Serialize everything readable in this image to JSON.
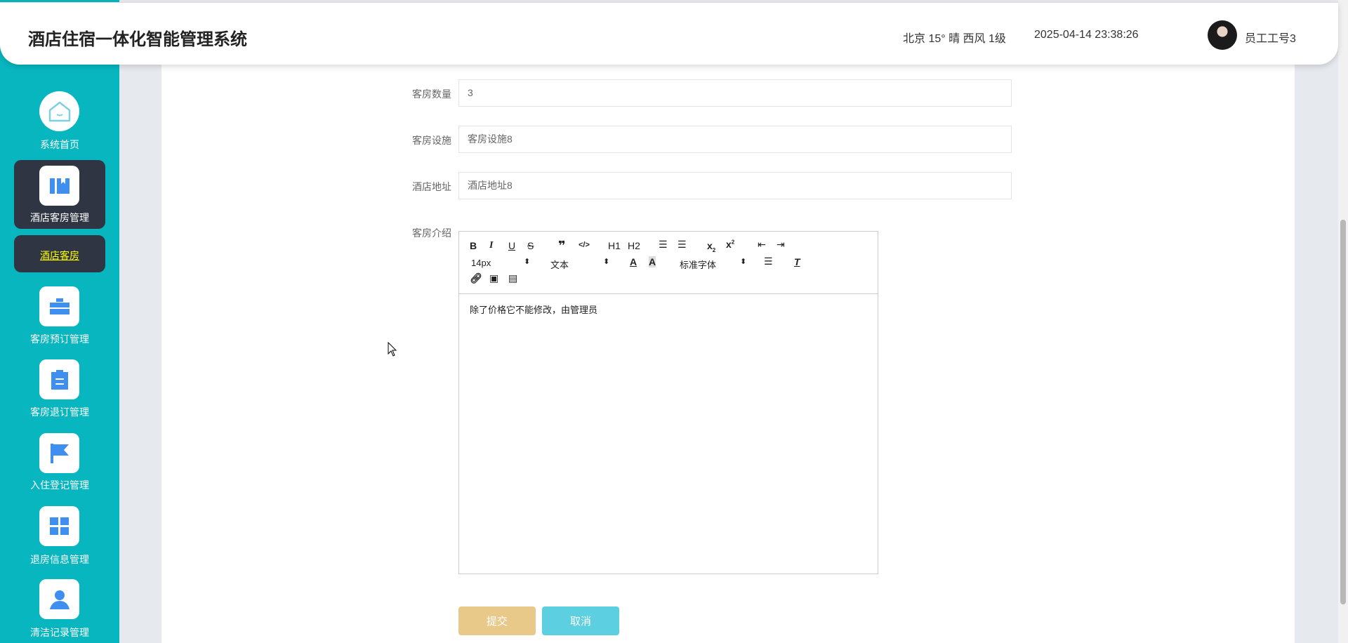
{
  "header": {
    "title": "酒店住宿一体化智能管理系统",
    "weather": "北京  15°  晴  西风  1级",
    "datetime": "2025-04-14 23:38:26",
    "username": "员工工号3"
  },
  "sidebar": {
    "items": [
      {
        "label": "系统首页",
        "icon": "home-icon"
      },
      {
        "label": "酒店客房管理",
        "icon": "book-icon",
        "active": true
      },
      {
        "label": "客房预订管理",
        "icon": "briefcase-icon"
      },
      {
        "label": "客房退订管理",
        "icon": "clipboard-icon"
      },
      {
        "label": "入住登记管理",
        "icon": "flag-icon"
      },
      {
        "label": "退房信息管理",
        "icon": "grid-icon"
      },
      {
        "label": "清洁记录管理",
        "icon": "user-icon"
      }
    ],
    "sub_item": "酒店客房"
  },
  "form": {
    "room_count": {
      "label": "客房数量",
      "value": "3"
    },
    "facilities": {
      "label": "客房设施",
      "value": "客房设施8"
    },
    "address": {
      "label": "酒店地址",
      "value": "酒店地址8"
    },
    "intro": {
      "label": "客房介绍",
      "content": "除了价格它不能修改，由管理员"
    },
    "toolbar": {
      "font_size": "14px",
      "heading": "文本",
      "font_family": "标准字体",
      "h1": "H1",
      "h2": "H2"
    },
    "submit": "提交",
    "cancel": "取消"
  },
  "colors": {
    "sidebar": "#07b6bf",
    "submit": "#e8c98a",
    "cancel": "#5ccfe0"
  }
}
